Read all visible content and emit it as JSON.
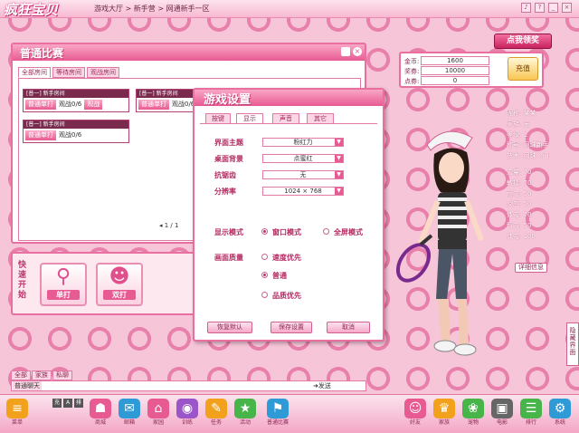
{
  "top": {
    "logo": "疯狂宝贝",
    "breadcrumb": "游戏大厅 > 新手营 > 网通新手一区",
    "controls": [
      "♪",
      "?",
      "_",
      "×"
    ]
  },
  "lobby": {
    "title": "普通比赛",
    "tabs": [
      "全部房间",
      "等待房间",
      "观战房间"
    ],
    "rooms": [
      {
        "name": "[普一] 新手房间",
        "mode": "普通单打",
        "spectate": "观战0/6",
        "badge": "观战"
      },
      {
        "name": "[普一] 新手房间",
        "mode": "普通单打",
        "spectate": "观战0/6",
        "badge": "观战"
      },
      {
        "name": "[普一] 新手房间",
        "mode": "普通单打",
        "spectate": "观战0/6",
        "badge": ""
      }
    ],
    "pager": "◂  1 / 1"
  },
  "quick_start": {
    "label": "快速开始",
    "buttons": [
      {
        "label": "单打",
        "icon": "racket-icon"
      },
      {
        "label": "双打",
        "icon": "players-icon"
      }
    ]
  },
  "chat": {
    "tabs": [
      "全部",
      "家族",
      "私聊"
    ],
    "channel": "普通聊天",
    "send": "发送"
  },
  "settings": {
    "title": "游戏设置",
    "tabs": [
      "按键",
      "显示",
      "声音",
      "其它"
    ],
    "rows": [
      {
        "label": "界面主题",
        "value": "粉红力"
      },
      {
        "label": "桌面背景",
        "value": "点蜜红"
      },
      {
        "label": "抗锯齿",
        "value": "无"
      },
      {
        "label": "分辨率",
        "value": "1024 × 768"
      }
    ],
    "display_mode": {
      "label": "显示模式",
      "options": [
        "窗口模式",
        "全屏模式"
      ],
      "selected": 0
    },
    "quality": {
      "label": "画面质量",
      "options": [
        "速度优先",
        "普通",
        "品质优先"
      ],
      "selected": 1
    },
    "buttons": [
      "恢复默认",
      "保存设置",
      "取消"
    ]
  },
  "currency": {
    "rows": [
      {
        "label": "金币:",
        "value": "1600"
      },
      {
        "label": "奖券:",
        "value": "10000"
      },
      {
        "label": "点券:",
        "value": "0"
      }
    ],
    "charge": "充值"
  },
  "bonus_button": "点我领奖",
  "profile": {
    "stats": [
      "昵称: 某某",
      "家族: 无",
      "等级: 1",
      "称号: 网球新手",
      "技术: 网球入门",
      "力量: 70",
      "敏捷: 70",
      "耐力: 50",
      "反应: 50",
      "体力: 70",
      "智力: 50",
      "体力: 100"
    ],
    "detail_button": "详细信息"
  },
  "side_tab": "隐藏界面",
  "bottom": {
    "left_items": [
      {
        "label": "菜单",
        "icon": "menu-icon",
        "color": "#f2a11c"
      },
      {
        "label": "商城",
        "icon": "shop-icon",
        "color": "#e85a92"
      },
      {
        "label": "邮箱",
        "icon": "mail-icon",
        "color": "#2e9ad6"
      },
      {
        "label": "家园",
        "icon": "home-icon",
        "color": "#e85a92"
      },
      {
        "label": "训练",
        "icon": "training-icon",
        "color": "#9a55c8"
      },
      {
        "label": "任务",
        "icon": "task-icon",
        "color": "#f2a11c"
      },
      {
        "label": "活动",
        "icon": "event-icon",
        "color": "#47b54a"
      },
      {
        "label": "普通比赛",
        "icon": "match-icon",
        "color": "#2e9ad6"
      }
    ],
    "mini_items": [
      "充",
      "A",
      "排"
    ],
    "right_items": [
      {
        "label": "好友",
        "icon": "friends-icon",
        "color": "#e85a92"
      },
      {
        "label": "家族",
        "icon": "family-icon",
        "color": "#f2a11c"
      },
      {
        "label": "宠物",
        "icon": "pet-icon",
        "color": "#47b54a"
      },
      {
        "label": "电影",
        "icon": "film-icon",
        "color": "#666666"
      },
      {
        "label": "排行",
        "icon": "rank-icon",
        "color": "#47b54a"
      },
      {
        "label": "系统",
        "icon": "system-icon",
        "color": "#2e9ad6"
      }
    ]
  }
}
